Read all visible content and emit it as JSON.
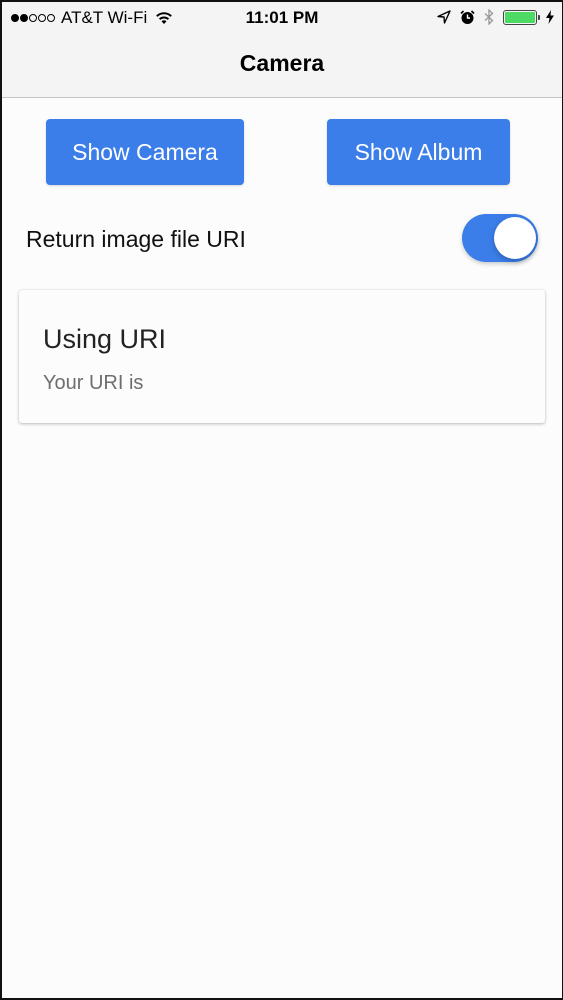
{
  "status_bar": {
    "signal_bars_filled": 2,
    "signal_bars_total": 5,
    "carrier": "AT&T Wi-Fi",
    "time": "11:01 PM",
    "icons": [
      "wifi-icon",
      "location-arrow-icon",
      "alarm-icon",
      "bluetooth-icon",
      "battery-icon",
      "charging-bolt-icon"
    ],
    "battery_level": 1.0,
    "battery_color": "#4cd964"
  },
  "navbar": {
    "title": "Camera"
  },
  "actions": {
    "show_camera_label": "Show Camera",
    "show_album_label": "Show Album",
    "accent_color": "#3b7de9"
  },
  "settings": {
    "return_uri_label": "Return image file URI",
    "return_uri_enabled": true
  },
  "result_card": {
    "title": "Using URI",
    "body": "Your URI is"
  }
}
